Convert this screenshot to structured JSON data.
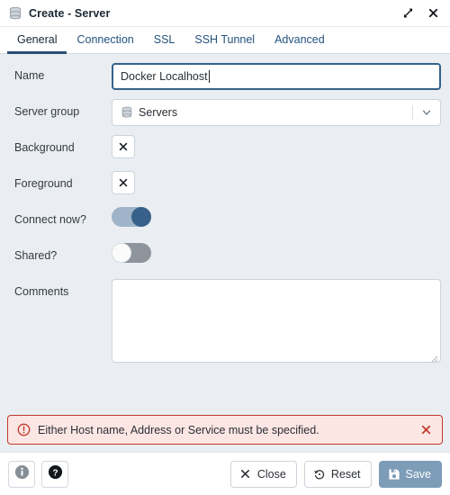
{
  "window": {
    "title": "Create - Server",
    "icon": "server-icon",
    "expand_icon": "expand-diagonal-icon",
    "close_icon": "close-icon"
  },
  "tabs": [
    {
      "label": "General",
      "active": true
    },
    {
      "label": "Connection",
      "active": false
    },
    {
      "label": "SSL",
      "active": false
    },
    {
      "label": "SSH Tunnel",
      "active": false
    },
    {
      "label": "Advanced",
      "active": false
    }
  ],
  "form": {
    "name": {
      "label": "Name",
      "value": "Docker Localhost",
      "placeholder": ""
    },
    "server_group": {
      "label": "Server group",
      "value": "Servers",
      "icon": "server-group-icon",
      "chevron": "chevron-down-icon"
    },
    "background": {
      "label": "Background",
      "value": "",
      "clear_icon": "close-icon"
    },
    "foreground": {
      "label": "Foreground",
      "value": "",
      "clear_icon": "close-icon"
    },
    "connect_now": {
      "label": "Connect now?",
      "state": "on"
    },
    "shared": {
      "label": "Shared?",
      "state": "off"
    },
    "comments": {
      "label": "Comments",
      "value": "",
      "placeholder": ""
    }
  },
  "alert": {
    "message": "Either Host name, Address or Service must be specified.",
    "icon": "error-circle-icon",
    "close_icon": "close-icon",
    "color": "#c0392b",
    "background": "#fbe6e4"
  },
  "footer": {
    "info_icon": "info-icon",
    "help_icon": "help-icon",
    "close_label": "Close",
    "close_icon": "close-icon",
    "reset_label": "Reset",
    "reset_icon": "reset-icon",
    "save_label": "Save",
    "save_icon": "save-floppy-icon",
    "save_disabled": true
  },
  "colors": {
    "accent": "#2a4f73",
    "body_background": "#eaeef2",
    "focus_border": "#35638a",
    "toggle_on": "#386189",
    "save_disabled": "#7d9cb7"
  }
}
